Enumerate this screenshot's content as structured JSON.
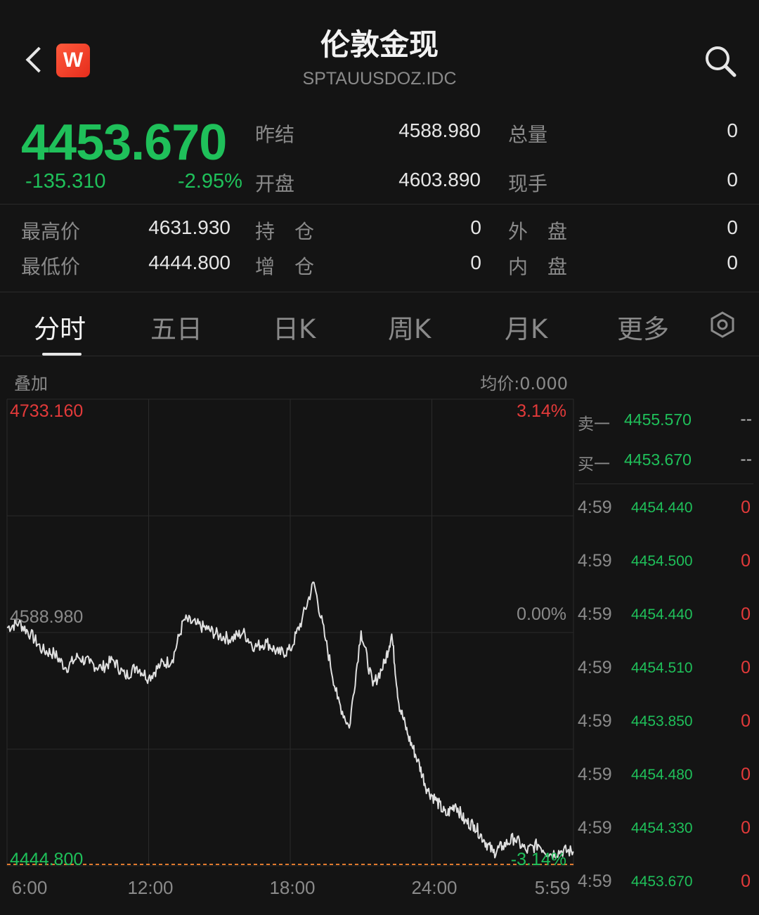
{
  "header": {
    "title": "伦敦金现",
    "subtitle": "SPTAUUSDOZ.IDC",
    "logo_letter": "W"
  },
  "quote": {
    "price": "4453.670",
    "change": "-135.310",
    "change_pct": "-2.95%",
    "prev_settle_label": "昨结",
    "prev_settle": "4588.980",
    "open_label": "开盘",
    "open": "4603.890",
    "volume_label": "总量",
    "volume": "0",
    "lot_label": "现手",
    "lot": "0"
  },
  "stats": {
    "high_label": "最高价",
    "high": "4631.930",
    "low_label": "最低价",
    "low": "4444.800",
    "oi_label": "持　仓",
    "oi": "0",
    "oi_chg_label": "增　仓",
    "oi_chg": "0",
    "outer_label": "外　盘",
    "outer": "0",
    "inner_label": "内　盘",
    "inner": "0"
  },
  "tabs": [
    "分时",
    "五日",
    "日K",
    "周K",
    "月K",
    "更多"
  ],
  "chart_header": {
    "overlay": "叠加",
    "avg_price": "均价:0.000"
  },
  "orderbook": {
    "ask_label": "卖一",
    "ask": "4455.570",
    "ask_vol": "--",
    "bid_label": "买一",
    "bid": "4453.670",
    "bid_vol": "--"
  },
  "ticks": [
    {
      "time": "4:59",
      "price": "4454.440",
      "vol": "0"
    },
    {
      "time": "4:59",
      "price": "4454.500",
      "vol": "0"
    },
    {
      "time": "4:59",
      "price": "4454.440",
      "vol": "0"
    },
    {
      "time": "4:59",
      "price": "4454.510",
      "vol": "0"
    },
    {
      "time": "4:59",
      "price": "4453.850",
      "vol": "0"
    },
    {
      "time": "4:59",
      "price": "4454.480",
      "vol": "0"
    },
    {
      "time": "4:59",
      "price": "4454.330",
      "vol": "0"
    },
    {
      "time": "4:59",
      "price": "4453.670",
      "vol": "0"
    }
  ],
  "colors": {
    "down": "#1fc05a",
    "up": "#e33a3a",
    "line": "#e0e0e0",
    "low_line": "#e07a2e"
  },
  "chart_data": {
    "type": "line",
    "y_top_label": "4733.160",
    "y_top_pct": "3.14%",
    "y_mid_label": "4588.980",
    "y_mid_pct": "0.00%",
    "y_bottom_label": "4444.800",
    "y_bottom_pct": "-3.14%",
    "ylim": [
      4444.8,
      4733.16
    ],
    "x_ticks": [
      "6:00",
      "12:00",
      "18:00",
      "24:00",
      "5:59"
    ],
    "series": [
      {
        "x": [
          0,
          0.5,
          1,
          1.5,
          2,
          2.5,
          3,
          3.5,
          4,
          4.5,
          5,
          5.5,
          6,
          6.5,
          7,
          7.5,
          8,
          8.5,
          9,
          9.5,
          10,
          10.5,
          11,
          11.5,
          12,
          12.5,
          13,
          13.5,
          14,
          14.5,
          15,
          15.5,
          16,
          16.3,
          16.6,
          17,
          17.4,
          17.8,
          18.2,
          18.6,
          19,
          19.4,
          19.8,
          20.2,
          20.6,
          21,
          21.5,
          22,
          22.5,
          23,
          23.5,
          23.99
        ],
        "y": [
          4592,
          4595,
          4588,
          4578,
          4576,
          4567,
          4574,
          4570,
          4567,
          4572,
          4562,
          4568,
          4561,
          4569,
          4572,
          4597,
          4594,
          4591,
          4587,
          4585,
          4589,
          4580,
          4583,
          4576,
          4578,
          4597,
          4620,
          4584,
          4548,
          4530,
          4590,
          4556,
          4570,
          4588,
          4545,
          4525,
          4510,
          4492,
          4485,
          4476,
          4483,
          4472,
          4470,
          4461,
          4453,
          4457,
          4462,
          4454,
          4458,
          4452,
          4454,
          4453.67
        ]
      }
    ]
  }
}
